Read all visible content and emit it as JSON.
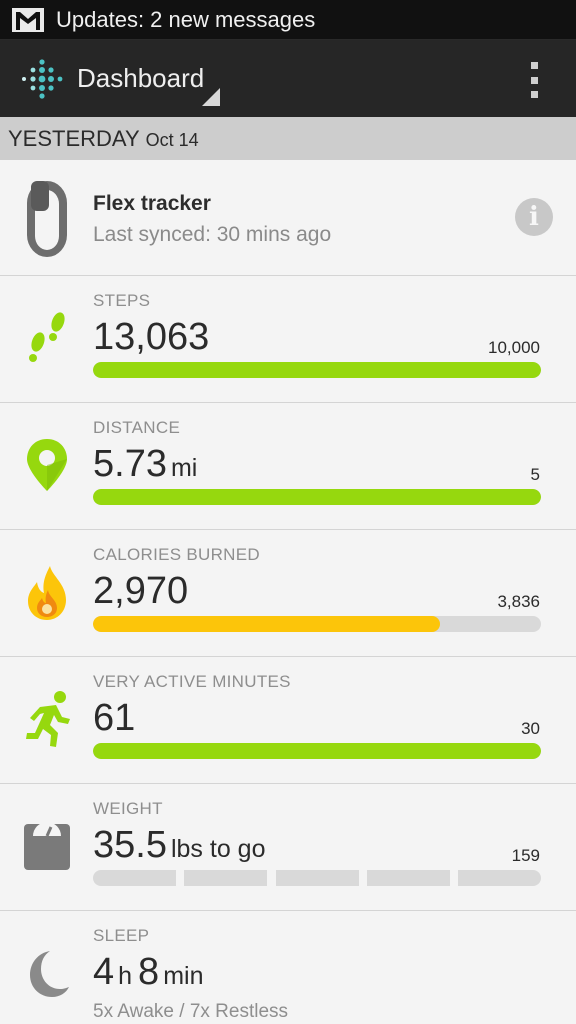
{
  "status_bar": {
    "notification_icon": "gmail-icon",
    "text": "Updates: 2 new messages"
  },
  "action_bar": {
    "logo_icon": "fitbit-logo-icon",
    "title": "Dashboard",
    "overflow_icon": "overflow-menu-icon"
  },
  "date_header": {
    "day": "YESTERDAY",
    "date": "Oct 14"
  },
  "device": {
    "icon": "flex-band-icon",
    "name": "Flex tracker",
    "last_synced": "Last synced: 30 mins ago",
    "info_glyph": "i"
  },
  "stats": {
    "steps": {
      "icon": "footsteps-icon",
      "label": "STEPS",
      "value": "13,063",
      "goal": "10,000",
      "progress": 1.0,
      "color": "#96d80e"
    },
    "distance": {
      "icon": "map-pin-icon",
      "label": "DISTANCE",
      "value": "5.73",
      "unit": "mi",
      "goal": "5",
      "progress": 1.0,
      "color": "#96d80e"
    },
    "calories": {
      "icon": "flame-icon",
      "label": "CALORIES BURNED",
      "value": "2,970",
      "goal": "3,836",
      "progress": 0.774,
      "color": "#fcc50a"
    },
    "active_minutes": {
      "icon": "running-person-icon",
      "label": "VERY ACTIVE MINUTES",
      "value": "61",
      "goal": "30",
      "progress": 1.0,
      "color": "#96d80e"
    },
    "weight": {
      "icon": "scale-icon",
      "label": "WEIGHT",
      "value": "35.5",
      "unit": "lbs to go",
      "goal": "159",
      "progress": 0.0
    },
    "sleep": {
      "icon": "moon-icon",
      "label": "SLEEP",
      "hours": "4",
      "hours_unit": "h",
      "minutes": "8",
      "minutes_unit": "min",
      "summary": "5x Awake / 7x Restless"
    }
  }
}
